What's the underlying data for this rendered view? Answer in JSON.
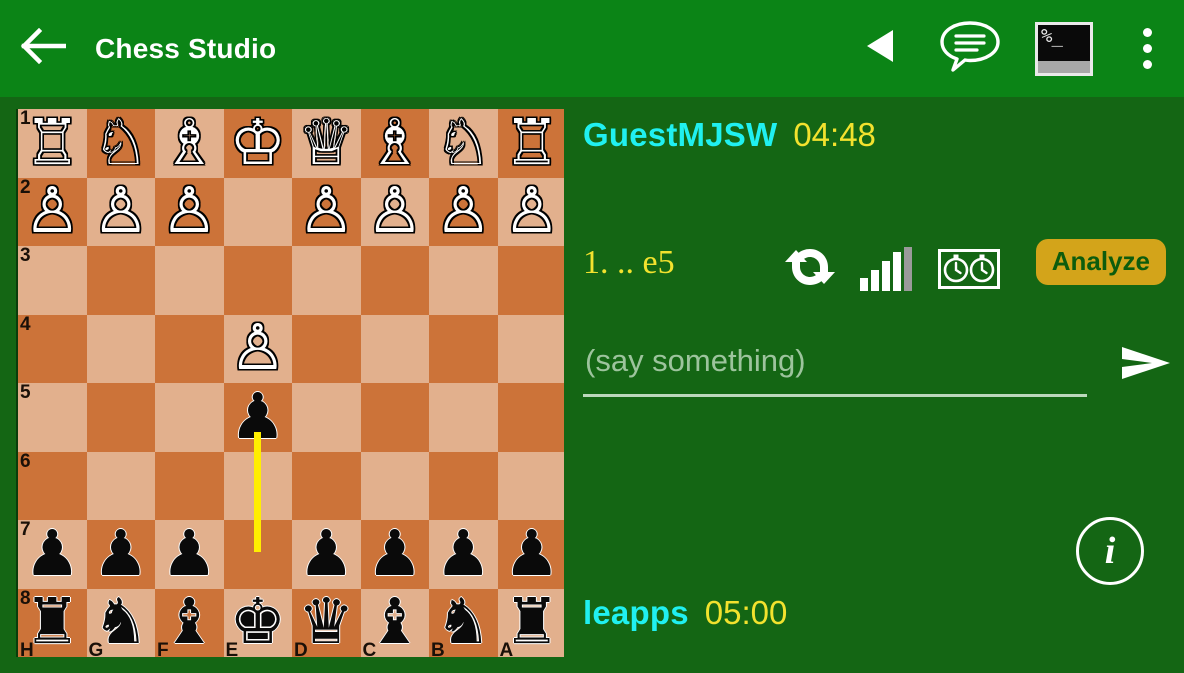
{
  "appbar": {
    "title": "Chess Studio",
    "back_icon": "arrow-left-icon",
    "prev_move_icon": "play-back-triangle-icon",
    "chat_icon": "chat-bubble-icon",
    "terminal_icon": "terminal-console-icon",
    "terminal_text": "%_",
    "overflow_icon": "more-vertical-icon",
    "bar_color": "#0b8416"
  },
  "board": {
    "orientation": "black",
    "light_color": "#e2b08d",
    "dark_color": "#cc7339",
    "rank_labels": [
      "1",
      "2",
      "3",
      "4",
      "5",
      "6",
      "7",
      "8"
    ],
    "file_labels": [
      "H",
      "G",
      "F",
      "E",
      "D",
      "C",
      "B",
      "A"
    ],
    "highlight_color": "#ffee00",
    "last_move": "e7-e5",
    "rows": [
      [
        {
          "piece": "white-rook",
          "glyph": "♖",
          "side": "w"
        },
        {
          "piece": "white-knight",
          "glyph": "♘",
          "side": "w"
        },
        {
          "piece": "white-bishop",
          "glyph": "♗",
          "side": "w"
        },
        {
          "piece": "white-king",
          "glyph": "♔",
          "side": "w"
        },
        {
          "piece": "white-queen",
          "glyph": "♕",
          "side": "w"
        },
        {
          "piece": "white-bishop",
          "glyph": "♗",
          "side": "w"
        },
        {
          "piece": "white-knight",
          "glyph": "♘",
          "side": "w"
        },
        {
          "piece": "white-rook",
          "glyph": "♖",
          "side": "w"
        }
      ],
      [
        {
          "piece": "white-pawn",
          "glyph": "♙",
          "side": "w"
        },
        {
          "piece": "white-pawn",
          "glyph": "♙",
          "side": "w"
        },
        {
          "piece": "white-pawn",
          "glyph": "♙",
          "side": "w"
        },
        {
          "piece": null,
          "glyph": "",
          "side": ""
        },
        {
          "piece": "white-pawn",
          "glyph": "♙",
          "side": "w"
        },
        {
          "piece": "white-pawn",
          "glyph": "♙",
          "side": "w"
        },
        {
          "piece": "white-pawn",
          "glyph": "♙",
          "side": "w"
        },
        {
          "piece": "white-pawn",
          "glyph": "♙",
          "side": "w"
        }
      ],
      [
        {
          "piece": null,
          "glyph": "",
          "side": ""
        },
        {
          "piece": null,
          "glyph": "",
          "side": ""
        },
        {
          "piece": null,
          "glyph": "",
          "side": ""
        },
        {
          "piece": null,
          "glyph": "",
          "side": ""
        },
        {
          "piece": null,
          "glyph": "",
          "side": ""
        },
        {
          "piece": null,
          "glyph": "",
          "side": ""
        },
        {
          "piece": null,
          "glyph": "",
          "side": ""
        },
        {
          "piece": null,
          "glyph": "",
          "side": ""
        }
      ],
      [
        {
          "piece": null,
          "glyph": "",
          "side": ""
        },
        {
          "piece": null,
          "glyph": "",
          "side": ""
        },
        {
          "piece": null,
          "glyph": "",
          "side": ""
        },
        {
          "piece": "white-pawn",
          "glyph": "♙",
          "side": "w"
        },
        {
          "piece": null,
          "glyph": "",
          "side": ""
        },
        {
          "piece": null,
          "glyph": "",
          "side": ""
        },
        {
          "piece": null,
          "glyph": "",
          "side": ""
        },
        {
          "piece": null,
          "glyph": "",
          "side": ""
        }
      ],
      [
        {
          "piece": null,
          "glyph": "",
          "side": ""
        },
        {
          "piece": null,
          "glyph": "",
          "side": ""
        },
        {
          "piece": null,
          "glyph": "",
          "side": ""
        },
        {
          "piece": "black-pawn",
          "glyph": "♟",
          "side": "b"
        },
        {
          "piece": null,
          "glyph": "",
          "side": ""
        },
        {
          "piece": null,
          "glyph": "",
          "side": ""
        },
        {
          "piece": null,
          "glyph": "",
          "side": ""
        },
        {
          "piece": null,
          "glyph": "",
          "side": ""
        }
      ],
      [
        {
          "piece": null,
          "glyph": "",
          "side": ""
        },
        {
          "piece": null,
          "glyph": "",
          "side": ""
        },
        {
          "piece": null,
          "glyph": "",
          "side": ""
        },
        {
          "piece": null,
          "glyph": "",
          "side": ""
        },
        {
          "piece": null,
          "glyph": "",
          "side": ""
        },
        {
          "piece": null,
          "glyph": "",
          "side": ""
        },
        {
          "piece": null,
          "glyph": "",
          "side": ""
        },
        {
          "piece": null,
          "glyph": "",
          "side": ""
        }
      ],
      [
        {
          "piece": "black-pawn",
          "glyph": "♟",
          "side": "b"
        },
        {
          "piece": "black-pawn",
          "glyph": "♟",
          "side": "b"
        },
        {
          "piece": "black-pawn",
          "glyph": "♟",
          "side": "b"
        },
        {
          "piece": null,
          "glyph": "",
          "side": ""
        },
        {
          "piece": "black-pawn",
          "glyph": "♟",
          "side": "b"
        },
        {
          "piece": "black-pawn",
          "glyph": "♟",
          "side": "b"
        },
        {
          "piece": "black-pawn",
          "glyph": "♟",
          "side": "b"
        },
        {
          "piece": "black-pawn",
          "glyph": "♟",
          "side": "b"
        }
      ],
      [
        {
          "piece": "black-rook",
          "glyph": "♜",
          "side": "b"
        },
        {
          "piece": "black-knight",
          "glyph": "♞",
          "side": "b"
        },
        {
          "piece": "black-bishop",
          "glyph": "♝",
          "side": "b"
        },
        {
          "piece": "black-king",
          "glyph": "♚",
          "side": "b"
        },
        {
          "piece": "black-queen",
          "glyph": "♛",
          "side": "b"
        },
        {
          "piece": "black-bishop",
          "glyph": "♝",
          "side": "b"
        },
        {
          "piece": "black-knight",
          "glyph": "♞",
          "side": "b"
        },
        {
          "piece": "black-rook",
          "glyph": "♜",
          "side": "b"
        }
      ]
    ]
  },
  "panel": {
    "top_player": {
      "name": "GuestMJSW",
      "clock": "04:48"
    },
    "bottom_player": {
      "name": "leapps",
      "clock": "05:00"
    },
    "move_text": "1. .. e5",
    "refresh_icon": "refresh-sync-icon",
    "signal_icon": "signal-bars-icon",
    "clocks_icon": "chess-clock-icon",
    "analyze_label": "Analyze",
    "analyze_bg": "#d3a41a",
    "chat_placeholder": "(say something)",
    "chat_value": "",
    "send_icon": "send-paper-plane-icon",
    "info_icon": "info-circle-icon",
    "info_glyph": "i",
    "name_color": "#20f0f0",
    "clock_color": "#f2e22e",
    "background": "#146614"
  }
}
